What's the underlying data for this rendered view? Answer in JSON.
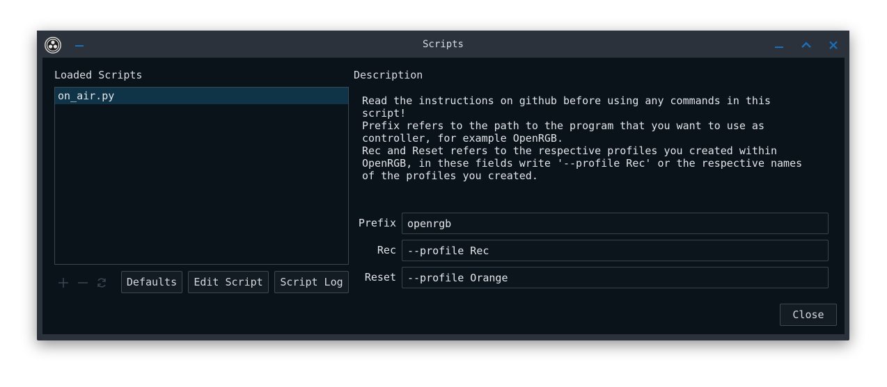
{
  "window": {
    "title": "Scripts"
  },
  "left_panel": {
    "label": "Loaded Scripts",
    "scripts": [
      {
        "name": "on_air.py",
        "selected": true
      }
    ],
    "tools": [
      "add-icon",
      "remove-icon",
      "reload-icon"
    ],
    "buttons": {
      "defaults": "Defaults",
      "edit_script": "Edit Script",
      "script_log": "Script Log"
    }
  },
  "right_panel": {
    "label": "Description",
    "description_lines": [
      "Read the instructions on github before using any commands in this",
      "script!",
      "Prefix refers to the path to the program that you want to use as",
      "controller, for example OpenRGB.",
      "Rec and Reset refers to the respective profiles you created within",
      "OpenRGB, in these fields write '--profile Rec' or the respective names",
      "of the profiles you created."
    ],
    "fields": {
      "prefix": {
        "label": "Prefix",
        "value": "openrgb"
      },
      "rec": {
        "label": "Rec",
        "value": "--profile Rec"
      },
      "reset": {
        "label": "Reset",
        "value": "--profile Orange"
      }
    },
    "close_label": "Close"
  },
  "colors": {
    "accent": "#1b6fbb",
    "background": "#0a121a",
    "titlebar": "#2b323b",
    "selection": "#0f3347"
  }
}
